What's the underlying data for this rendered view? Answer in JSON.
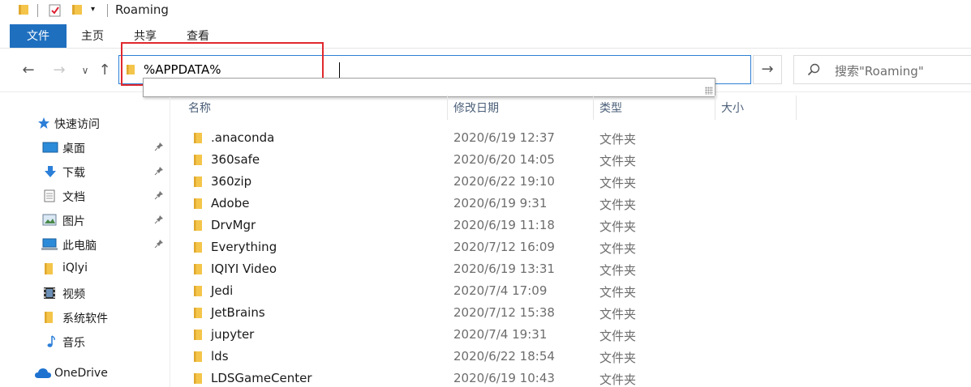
{
  "window": {
    "title": "Roaming"
  },
  "ribbon": {
    "tabs": [
      "文件",
      "主页",
      "共享",
      "查看"
    ]
  },
  "address": {
    "value": "%APPDATA%"
  },
  "search": {
    "placeholder": "搜索\"Roaming\""
  },
  "sidebar": {
    "items": [
      {
        "label": "快速访问",
        "icon": "star-icon",
        "pinned": false
      },
      {
        "label": "桌面",
        "icon": "desktop-icon",
        "pinned": true
      },
      {
        "label": "下载",
        "icon": "download-icon",
        "pinned": true
      },
      {
        "label": "文档",
        "icon": "document-icon",
        "pinned": true
      },
      {
        "label": "图片",
        "icon": "pictures-icon",
        "pinned": true
      },
      {
        "label": "此电脑",
        "icon": "computer-icon",
        "pinned": true
      },
      {
        "label": "iQlyi",
        "icon": "folder-icon",
        "pinned": false
      },
      {
        "label": "视频",
        "icon": "video-icon",
        "pinned": false
      },
      {
        "label": "系统软件",
        "icon": "folder-icon",
        "pinned": false
      },
      {
        "label": "音乐",
        "icon": "music-icon",
        "pinned": false
      },
      {
        "label": "OneDrive",
        "icon": "cloud-icon",
        "pinned": false
      }
    ]
  },
  "columns": {
    "name": "名称",
    "date": "修改日期",
    "type": "类型",
    "size": "大小"
  },
  "files": [
    {
      "name": ".anaconda",
      "date": "2020/6/19 12:37",
      "type": "文件夹"
    },
    {
      "name": "360safe",
      "date": "2020/6/20 14:05",
      "type": "文件夹"
    },
    {
      "name": "360zip",
      "date": "2020/6/22 19:10",
      "type": "文件夹"
    },
    {
      "name": "Adobe",
      "date": "2020/6/19 9:31",
      "type": "文件夹"
    },
    {
      "name": "DrvMgr",
      "date": "2020/6/19 11:18",
      "type": "文件夹"
    },
    {
      "name": "Everything",
      "date": "2020/7/12 16:09",
      "type": "文件夹"
    },
    {
      "name": "IQIYI Video",
      "date": "2020/6/19 13:31",
      "type": "文件夹"
    },
    {
      "name": "Jedi",
      "date": "2020/7/4 17:09",
      "type": "文件夹"
    },
    {
      "name": "JetBrains",
      "date": "2020/7/12 15:38",
      "type": "文件夹"
    },
    {
      "name": "jupyter",
      "date": "2020/7/4 19:31",
      "type": "文件夹"
    },
    {
      "name": "lds",
      "date": "2020/6/22 18:54",
      "type": "文件夹"
    },
    {
      "name": "LDSGameCenter",
      "date": "2020/6/19 10:43",
      "type": "文件夹"
    }
  ],
  "colors": {
    "accent": "#1f6fbf",
    "folder": "#f4c54a",
    "highlight": "#e0282e"
  }
}
